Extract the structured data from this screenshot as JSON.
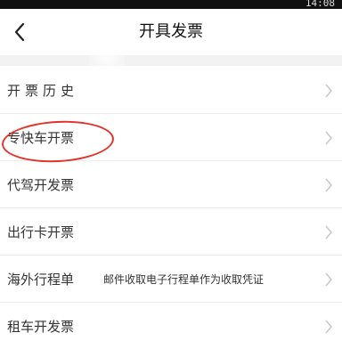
{
  "status_bar": {
    "time": "14:08"
  },
  "nav": {
    "title": "开具发票"
  },
  "rows": [
    {
      "label": "开票历史",
      "note": ""
    },
    {
      "label": "专快车开票",
      "note": ""
    },
    {
      "label": "代驾开发票",
      "note": ""
    },
    {
      "label": "出行卡开票",
      "note": ""
    },
    {
      "label": "海外行程单",
      "note": "邮件收取电子行程单作为收取凭证"
    },
    {
      "label": "租车开发票",
      "note": ""
    }
  ],
  "colors": {
    "highlight": "#e2322a",
    "chevron": "#c8c8c8"
  },
  "icons": {
    "back": "chevron-left-icon",
    "row_arrow": "chevron-right-icon"
  }
}
